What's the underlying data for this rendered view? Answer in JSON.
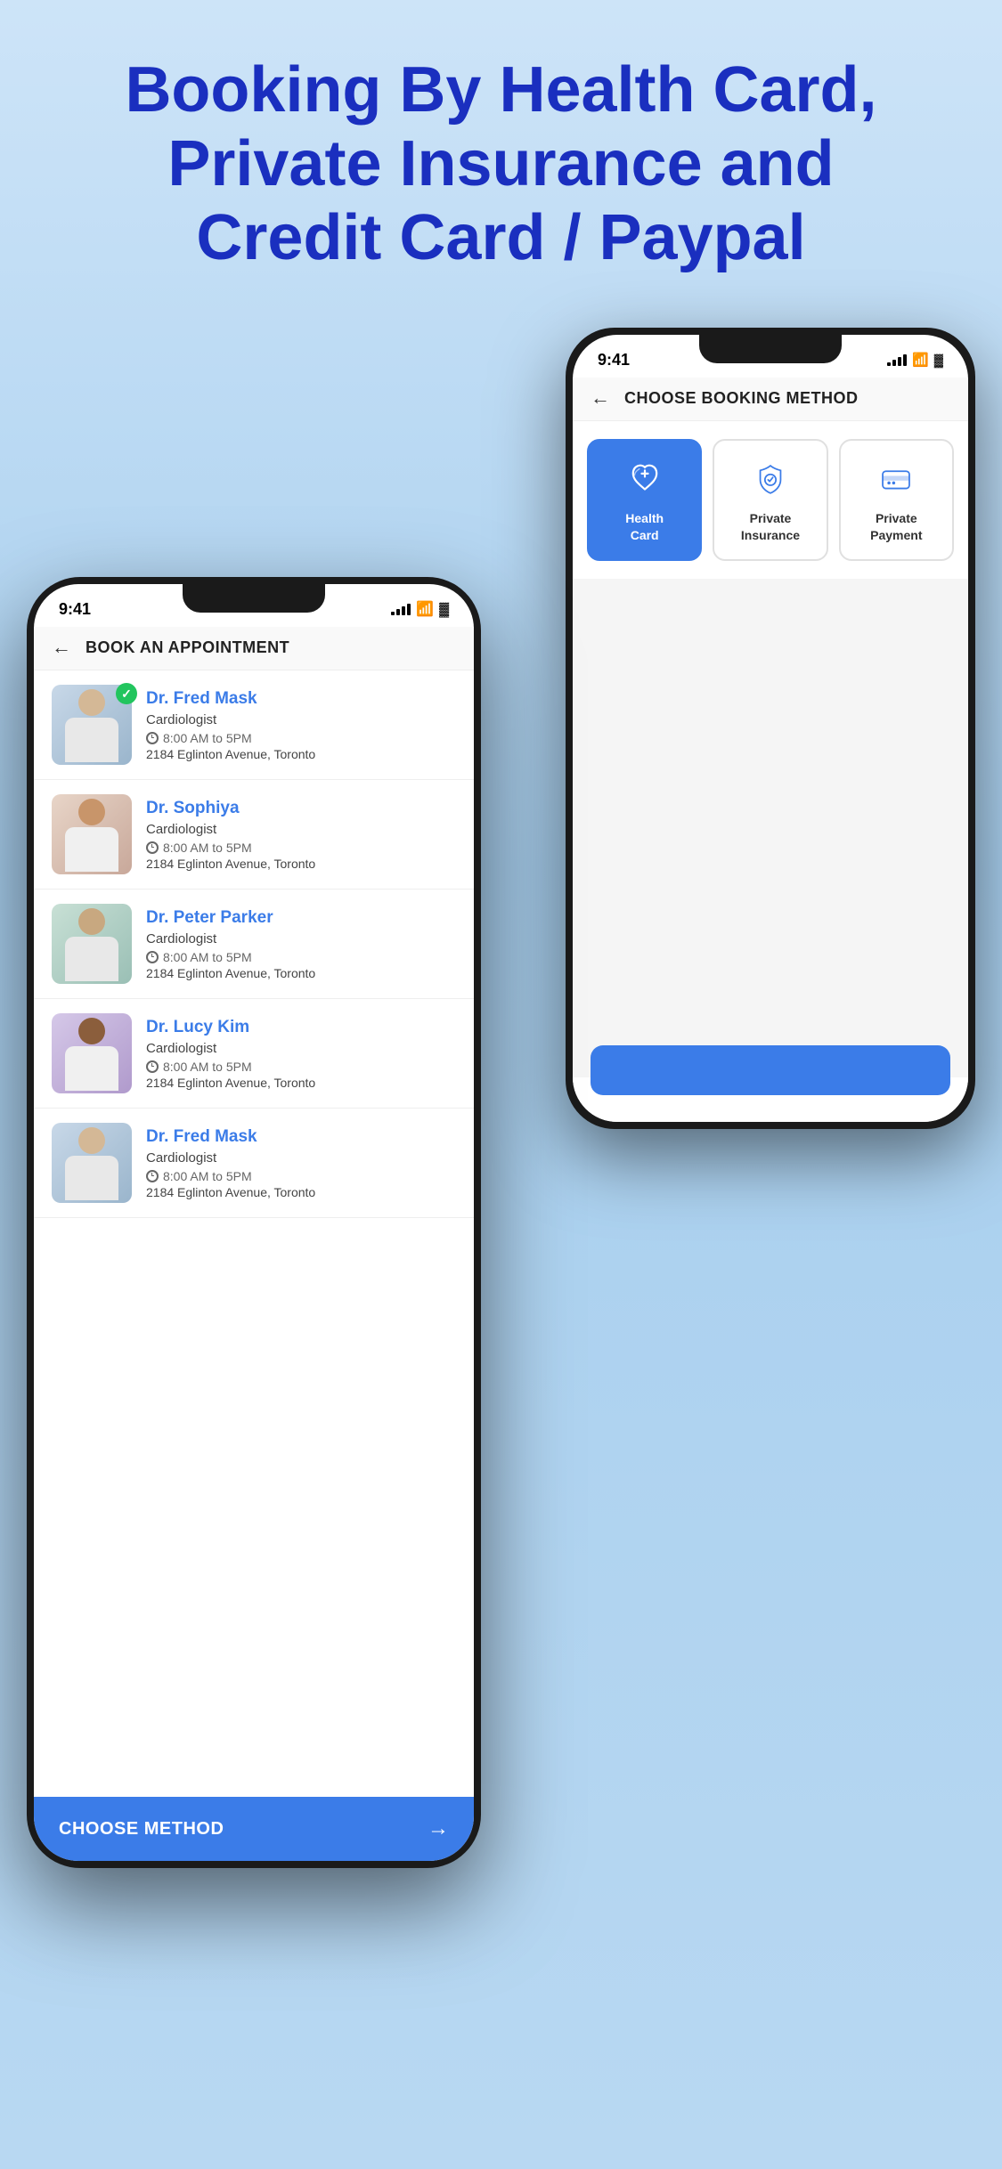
{
  "headline": "Booking By Health Card, Private Insurance and Credit Card / Paypal",
  "back_phone": {
    "time": "9:41",
    "title": "CHOOSE BOOKING METHOD",
    "methods": [
      {
        "id": "health-card",
        "label": "Health\nCard",
        "active": true
      },
      {
        "id": "private-insurance",
        "label": "Private\nInsurance",
        "active": false
      },
      {
        "id": "private-payment",
        "label": "Private\nPayment",
        "active": false
      }
    ]
  },
  "front_phone": {
    "time": "9:41",
    "title": "BOOK AN APPOINTMENT",
    "doctors": [
      {
        "name": "Dr. Fred Mask",
        "specialty": "Cardiologist",
        "time": "8:00 AM to 5PM",
        "address": "2184 Eglinton Avenue, Toronto",
        "selected": true,
        "avatar_class": "avatar-1"
      },
      {
        "name": "Dr. Sophiya",
        "specialty": "Cardiologist",
        "time": "8:00 AM to 5PM",
        "address": "2184 Eglinton Avenue, Toronto",
        "selected": false,
        "avatar_class": "avatar-2"
      },
      {
        "name": "Dr. Peter Parker",
        "specialty": "Cardiologist",
        "time": "8:00 AM to 5PM",
        "address": "2184 Eglinton Avenue, Toronto",
        "selected": false,
        "avatar_class": "avatar-3"
      },
      {
        "name": "Dr. Lucy Kim",
        "specialty": "Cardiologist",
        "time": "8:00 AM to 5PM",
        "address": "2184 Eglinton Avenue, Toronto",
        "selected": false,
        "avatar_class": "avatar-4"
      },
      {
        "name": "Dr. Fred Mask",
        "specialty": "Cardiologist",
        "time": "8:00 AM to 5PM",
        "address": "2184 Eglinton Avenue, Toronto",
        "selected": false,
        "avatar_class": "avatar-5"
      }
    ],
    "choose_method_label": "CHOOSE METHOD",
    "arrow": "→"
  },
  "colors": {
    "primary": "#3b7ce8",
    "headline": "#1a2fbf",
    "background_gradient_top": "#cde4f8",
    "background_gradient_bottom": "#b8d8f2"
  }
}
